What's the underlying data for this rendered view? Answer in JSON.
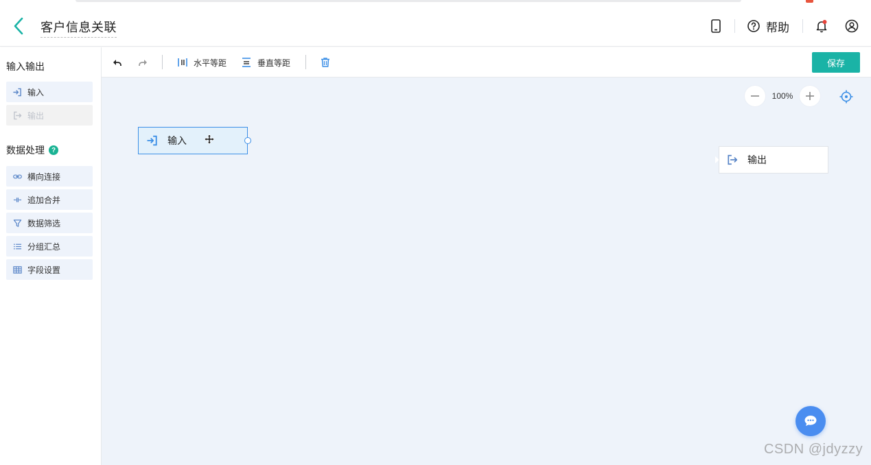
{
  "header": {
    "title": "客户信息关联",
    "help_label": "帮助"
  },
  "sidebar": {
    "io_section_title": "输入输出",
    "io_items": [
      {
        "label": "输入",
        "icon": "input-icon",
        "enabled": true
      },
      {
        "label": "输出",
        "icon": "output-icon",
        "enabled": false
      }
    ],
    "processing_section_title": "数据处理",
    "processing_items": [
      {
        "label": "横向连接",
        "icon": "link-icon"
      },
      {
        "label": "追加合并",
        "icon": "merge-icon"
      },
      {
        "label": "数据筛选",
        "icon": "filter-icon"
      },
      {
        "label": "分组汇总",
        "icon": "list-icon"
      },
      {
        "label": "字段设置",
        "icon": "table-icon"
      }
    ]
  },
  "toolbar": {
    "horizontal_label": "水平等距",
    "vertical_label": "垂直等距",
    "save_label": "保存"
  },
  "canvas": {
    "zoom": "100%",
    "input_node_label": "输入",
    "output_node_label": "输出"
  },
  "watermark": "CSDN @jdyzzy",
  "colors": {
    "accent": "#1ab3a6",
    "node_border": "#3a8ee6",
    "canvas_bg": "#eef3fa",
    "chat_fab": "#4a8df0"
  }
}
